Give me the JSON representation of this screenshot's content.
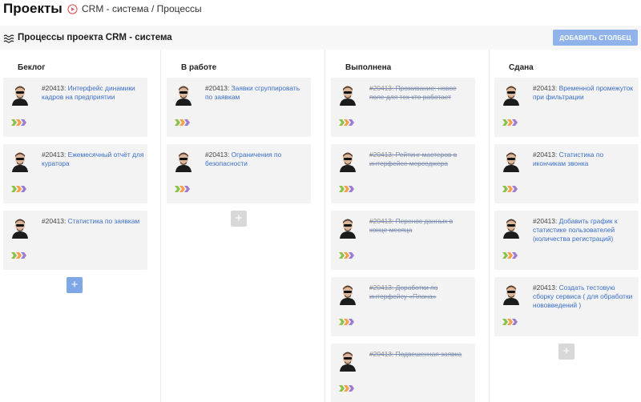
{
  "header": {
    "title": "Проекты",
    "breadcrumb": "CRM - система / Процессы"
  },
  "subheader": {
    "title": "Процессы проекта CRM - система",
    "add_column_label": "ДОБАВИТЬ СТОЛБЕЦ"
  },
  "columns": [
    {
      "title": "Беклог",
      "icon": "backlog-icon",
      "cards": [
        {
          "num": "#20413:",
          "text": "Интерфейс динамики кадров на предприятии"
        },
        {
          "num": "#20413:",
          "text": "Ежемесячный отчёт для куратора"
        },
        {
          "num": "#20413:",
          "text": "Статистика по заявкам"
        }
      ],
      "add_label": "+"
    },
    {
      "title": "В работе",
      "icon": "play-icon",
      "cards": [
        {
          "num": "#20413:",
          "text": "Заявки сгруппировать по заявкам"
        },
        {
          "num": "#20413:",
          "text": "Ограничения по безопасности"
        }
      ],
      "add_label": "+"
    },
    {
      "title": "Выполнена",
      "icon": "progress-icon",
      "cards": [
        {
          "num": "#20413:",
          "text": "Проживание: новое поле для тех кто работает"
        },
        {
          "num": "#20413:",
          "text": "Рейтинг мастеров в интерфейсе мерседжера"
        },
        {
          "num": "#20413:",
          "text": "Перенос данных в конце месяца"
        },
        {
          "num": "#20413:",
          "text": "Доработки по интерфейсу «Плана»"
        },
        {
          "num": "#20413:",
          "text": "Подвешенная заявка"
        }
      ]
    },
    {
      "title": "Сдана",
      "icon": "check-circle-icon",
      "cards": [
        {
          "num": "#20413:",
          "text": "Временной промежуток при фильтрации"
        },
        {
          "num": "#20413:",
          "text": "Статистика по икончикам звонка"
        },
        {
          "num": "#20413:",
          "text": "Добавить график к статистике пользователей (количества регистраций)"
        },
        {
          "num": "#20413:",
          "text": "Создать тестовую сборку сервиса ( для обработки нововведений )"
        }
      ],
      "add_label": "+"
    }
  ],
  "colors": {
    "accent": "#7ea7e6",
    "link": "#3a6ec8",
    "card_bg": "#f3f3f3",
    "arrow_green": "#8bc34a",
    "arrow_orange": "#f5a04a",
    "arrow_purple": "#9c7bd0"
  }
}
